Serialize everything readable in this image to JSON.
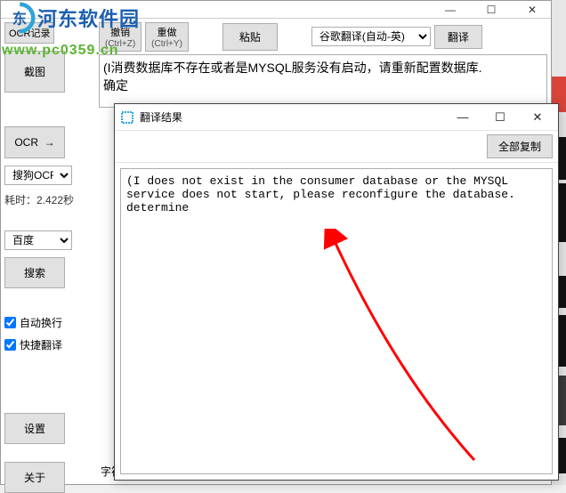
{
  "watermark": {
    "site_name": "河东软件园",
    "url": "www.pc0359.cn"
  },
  "main": {
    "title_controls": {
      "min": "—",
      "max": "☐",
      "close": "✕"
    },
    "ocr_record": "OCR记录",
    "undo": "撤销",
    "undo_key": "(Ctrl+Z)",
    "redo": "重做",
    "redo_key": "(Ctrl+Y)",
    "paste": "粘贴",
    "translate_engine": "谷歌翻译(自动-英)",
    "translate_btn": "翻译",
    "main_text": "(I消费数据库不存在或者是MYSQL服务没有启动，请重新配置数据库.\n确定"
  },
  "left": {
    "screenshot": "截图",
    "ocr_label": "OCR",
    "arrow": "→",
    "ocr_engine": "搜狗OCR",
    "timing": "耗时：2.422秒",
    "search_engine": "百度",
    "search_btn": "搜索",
    "auto_wrap": "自动换行",
    "quick_translate": "快捷翻译",
    "settings": "设置",
    "about": "关于"
  },
  "bottom": {
    "char_stats": "字符统"
  },
  "popup": {
    "title": "翻译结果",
    "controls": {
      "min": "—",
      "max": "☐",
      "close": "✕"
    },
    "copy_all": "全部复制",
    "body": "(I does not exist in the consumer database or the MYSQL service does not start, please reconfigure the database.\ndetermine"
  }
}
